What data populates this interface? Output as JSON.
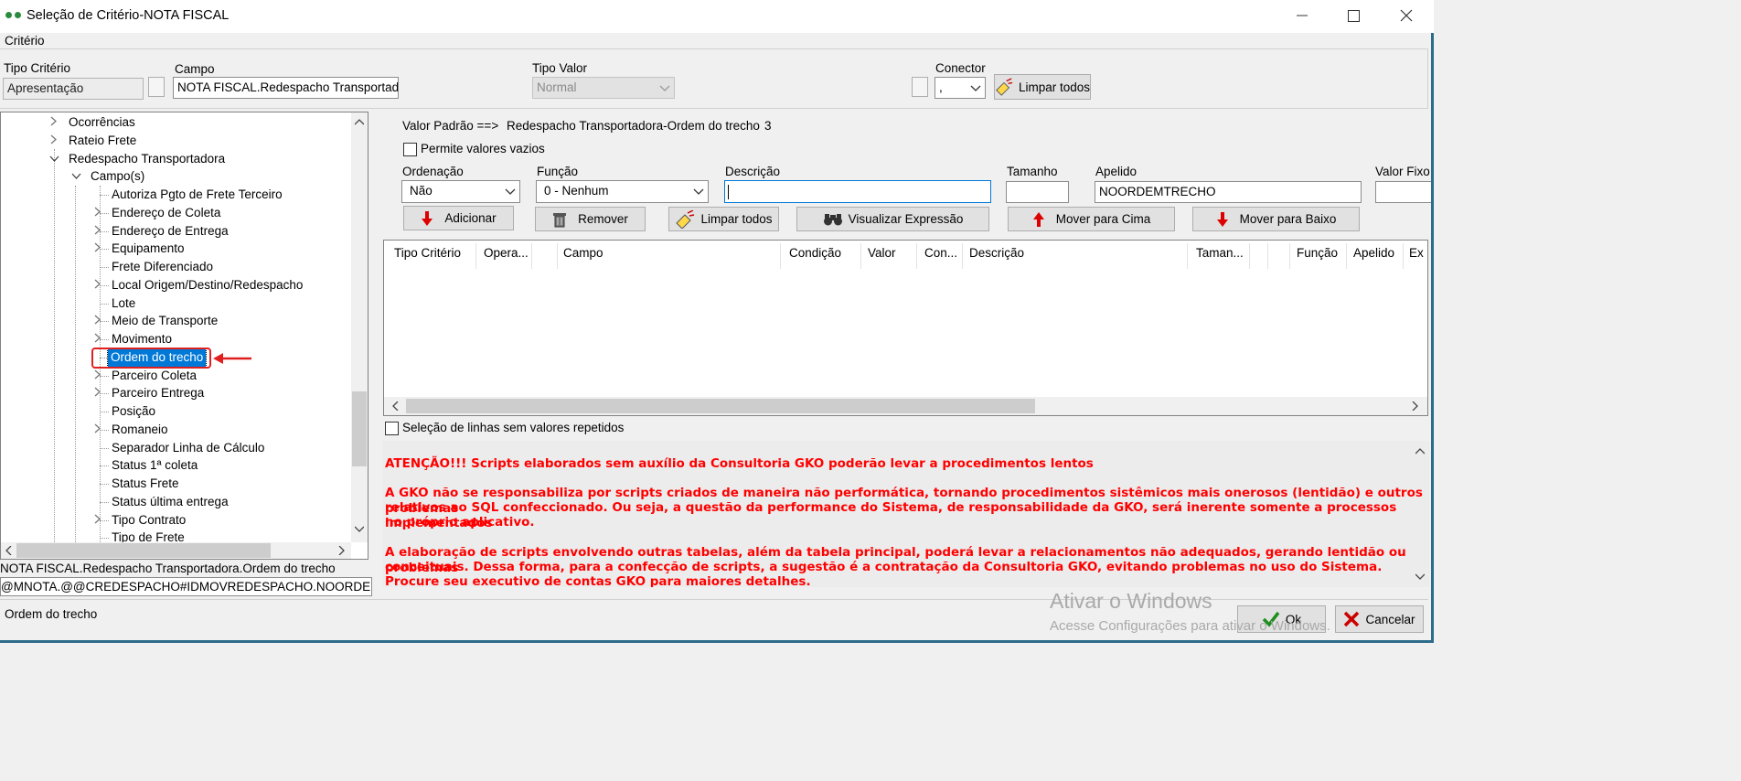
{
  "window": {
    "title": "Seleção de Critério-NOTA FISCAL",
    "min_icon": "minimize-icon",
    "max_icon": "maximize-icon",
    "close_icon": "close-icon"
  },
  "criterio": {
    "group_label": "Critério",
    "tipo_criterio_label": "Tipo Critério",
    "tipo_criterio_value": "Apresentação",
    "campo_label": "Campo",
    "campo_value": "NOTA FISCAL.Redespacho Transportad",
    "tipo_valor_label": "Tipo Valor",
    "tipo_valor_value": "Normal",
    "conector_label": "Conector",
    "conector_value": ",",
    "limpar_todos": "Limpar todos"
  },
  "tree": {
    "items": [
      {
        "label": "Ocorrências",
        "level": 1,
        "expander": ">"
      },
      {
        "label": "Rateio Frete",
        "level": 1,
        "expander": ">"
      },
      {
        "label": "Redespacho Transportadora",
        "level": 1,
        "expander": "v"
      },
      {
        "label": "Campo(s)",
        "level": 2,
        "expander": "v"
      },
      {
        "label": "Autoriza Pgto de Frete Terceiro",
        "level": 3,
        "expander": ""
      },
      {
        "label": "Endereço de Coleta",
        "level": 3,
        "expander": ">"
      },
      {
        "label": "Endereço de Entrega",
        "level": 3,
        "expander": ">"
      },
      {
        "label": "Equipamento",
        "level": 3,
        "expander": ">"
      },
      {
        "label": "Frete Diferenciado",
        "level": 3,
        "expander": ""
      },
      {
        "label": "Local Origem/Destino/Redespacho",
        "level": 3,
        "expander": ">"
      },
      {
        "label": "Lote",
        "level": 3,
        "expander": ""
      },
      {
        "label": "Meio de Transporte",
        "level": 3,
        "expander": ">"
      },
      {
        "label": "Movimento",
        "level": 3,
        "expander": ">"
      },
      {
        "label": "Ordem do trecho",
        "level": 3,
        "expander": "",
        "selected": true
      },
      {
        "label": "Parceiro Coleta",
        "level": 3,
        "expander": ">"
      },
      {
        "label": "Parceiro Entrega",
        "level": 3,
        "expander": ">"
      },
      {
        "label": "Posição",
        "level": 3,
        "expander": ""
      },
      {
        "label": "Romaneio",
        "level": 3,
        "expander": ">"
      },
      {
        "label": "Separador Linha de Cálculo",
        "level": 3,
        "expander": ""
      },
      {
        "label": "Status 1ª coleta",
        "level": 3,
        "expander": ""
      },
      {
        "label": "Status Frete",
        "level": 3,
        "expander": ""
      },
      {
        "label": "Status última entrega",
        "level": 3,
        "expander": ""
      },
      {
        "label": "Tipo Contrato",
        "level": 3,
        "expander": ">"
      },
      {
        "label": "Tipo de Frete",
        "level": 3,
        "expander": ""
      }
    ],
    "path_text": "NOTA FISCAL.Redespacho Transportadora.Ordem do trecho",
    "expr_text": "@MNOTA.@@CREDESPACHO#IDMOVREDESPACHO.NOORDEM"
  },
  "status_text": "Ordem do trecho",
  "valor_padrao": {
    "label": "Valor Padrão ==>",
    "value": "Redespacho Transportadora-Ordem do trecho",
    "number": "3"
  },
  "permite_vazios": "Permite valores vazios",
  "form": {
    "ordenacao_label": "Ordenação",
    "ordenacao_value": "Não",
    "funcao_label": "Função",
    "funcao_value": "0 - Nenhum",
    "descricao_label": "Descrição",
    "descricao_value": "",
    "tamanho_label": "Tamanho",
    "tamanho_value": "",
    "apelido_label": "Apelido",
    "apelido_value": "NOORDEMTRECHO",
    "valor_fixo_label": "Valor Fixo"
  },
  "buttons": {
    "adicionar": "Adicionar",
    "remover": "Remover",
    "limpar_todos": "Limpar todos",
    "visualizar": "Visualizar Expressão",
    "mover_cima": "Mover para Cima",
    "mover_baixo": "Mover para Baixo",
    "ok": "Ok",
    "cancelar": "Cancelar"
  },
  "grid_columns": [
    "Tipo Critério",
    "Opera...",
    "",
    "Campo",
    "Condição",
    "Valor",
    "Con...",
    "Descrição",
    "Taman...",
    "",
    "",
    "Função",
    "Apelido",
    "Ex"
  ],
  "selecao_linhas": "Seleção de linhas sem valores repetidos",
  "warning": {
    "title": "ATENÇÃO!!! Scripts elaborados sem auxílio da Consultoria GKO poderão levar a procedimentos lentos",
    "p1_l1": "A GKO não se responsabiliza por scripts criados de maneira não performática, tornando procedimentos sistêmicos mais onerosos (lentidão) e outros problemas",
    "p1_l2": "relativos ao SQL confeccionado. Ou seja, a questão da performance do Sistema, de responsabilidade da GKO, será inerente somente a processos implementados",
    "p1_l3": "no próprio aplicativo.",
    "p2_l1": "A elaboração de scripts envolvendo outras tabelas, além da tabela principal, poderá levar a relacionamentos não adequados, gerando lentidão ou problemas",
    "p2_l2": "conceituais. Dessa forma, para a confecção de scripts, a sugestão é a contratação da Consultoria GKO, evitando problemas no uso do Sistema.",
    "p2_l3": "Procure seu executivo de contas GKO para maiores detalhes."
  },
  "watermark": {
    "line1": "Ativar o Windows",
    "line2": "Acesse Configurações para ativar o Windows."
  },
  "colors": {
    "selection": "#0078d7",
    "annotation": "#e02020",
    "warning_text": "#ff0000"
  }
}
